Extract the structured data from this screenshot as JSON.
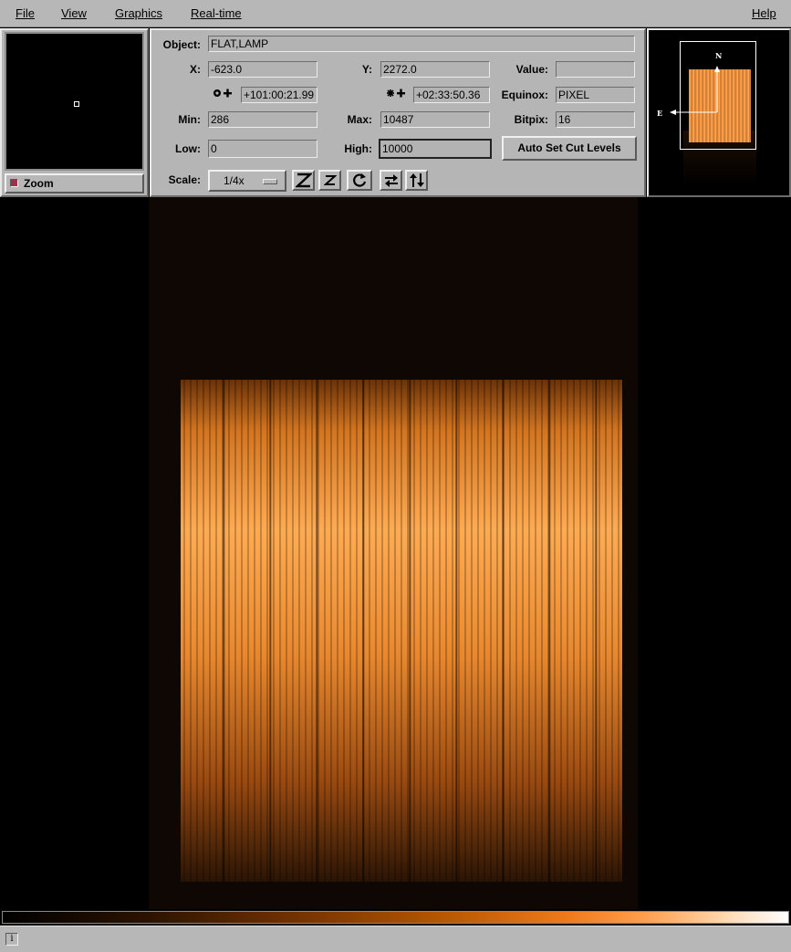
{
  "menu": {
    "file": "File",
    "view": "View",
    "graphics": "Graphics",
    "realtime": "Real-time",
    "help": "Help"
  },
  "zoom": {
    "label": "Zoom"
  },
  "info": {
    "object_label": "Object:",
    "object_value": "FLAT,LAMP",
    "x_label": "X:",
    "x_value": "-623.0",
    "y_label": "Y:",
    "y_value": "2272.0",
    "value_label": "Value:",
    "value_value": "",
    "ra_value": "+101:00:21.99",
    "dec_value": "+02:33:50.36",
    "equinox_label": "Equinox:",
    "equinox_value": "PIXEL",
    "min_label": "Min:",
    "min_value": "286",
    "max_label": "Max:",
    "max_value": "10487",
    "bitpix_label": "Bitpix:",
    "bitpix_value": "16",
    "low_label": "Low:",
    "low_value": "0",
    "high_label": "High:",
    "high_value": "10000",
    "auto_cut_label": "Auto Set Cut Levels",
    "scale_label": "Scale:",
    "scale_value": "1/4x"
  },
  "pan": {
    "north_label": "N",
    "east_label": "E"
  },
  "icons": {
    "ra": "world-coord-ra-icon",
    "dec": "world-coord-dec-icon",
    "zoom_in": "zoom-in-icon",
    "zoom_out": "zoom-out-icon",
    "rotate": "rotate-icon",
    "flip_x": "flip-x-icon",
    "flip_y": "flip-y-icon",
    "status": "info-icon"
  },
  "colors": {
    "panel": "#b5b5b5",
    "image_bright": "#ffa54a",
    "image_mid": "#c86a14",
    "image_dark": "#1a0c02"
  }
}
